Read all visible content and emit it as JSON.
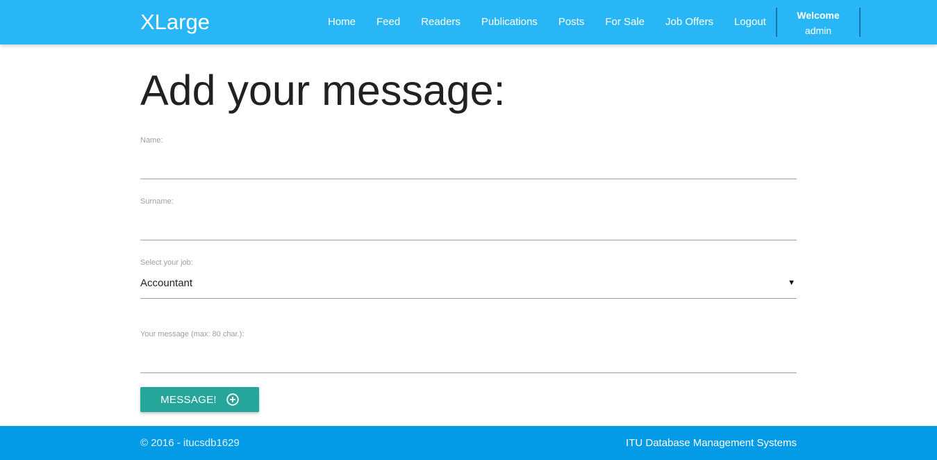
{
  "navbar": {
    "brand": "XLarge",
    "links": [
      "Home",
      "Feed",
      "Readers",
      "Publications",
      "Posts",
      "For Sale",
      "Job Offers",
      "Logout"
    ],
    "welcome_title": "Welcome",
    "welcome_user": "admin",
    "color": "#29b6f6"
  },
  "main": {
    "title": "Add your message:",
    "fields": {
      "name_label": "Name:",
      "name_value": "",
      "surname_label": "Surname:",
      "surname_value": "",
      "job_label": "Select your job:",
      "job_selected": "Accountant",
      "message_label": "Your message (max: 80 char.):",
      "message_value": ""
    },
    "submit_label": "MESSAGE!",
    "submit_icon": "add-circle-icon",
    "button_color": "#26a69a"
  },
  "footer": {
    "copyright": "© 2016 - itucsdb1629",
    "right_text": "ITU Database Management Systems",
    "color": "#039be5"
  }
}
